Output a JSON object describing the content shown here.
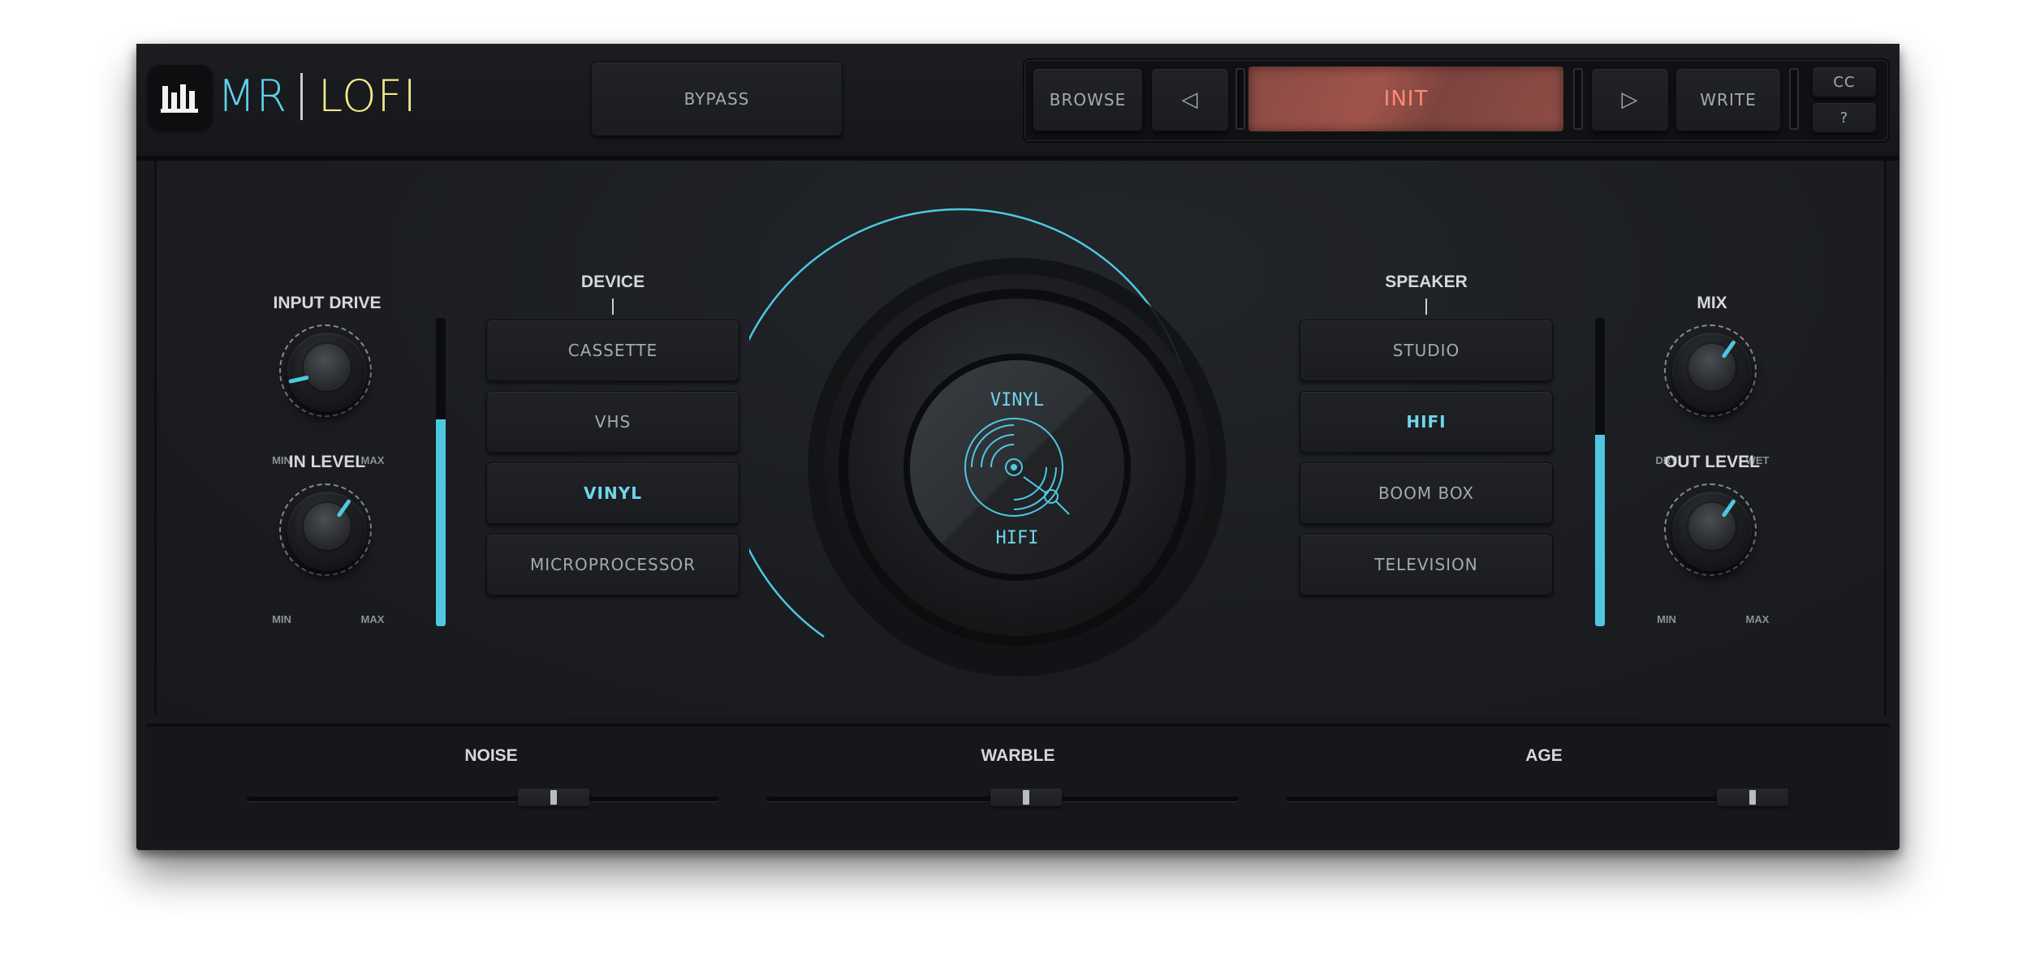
{
  "header": {
    "logo_left": "MR",
    "logo_right": "LOFI",
    "bypass_label": "BYPASS",
    "browse_label": "BROWSE",
    "prev_label": "◁",
    "preset_name": "INIT",
    "next_label": "▷",
    "write_label": "WRITE",
    "cc_label": "CC",
    "help_label": "?"
  },
  "left": {
    "input_drive": {
      "label": "INPUT DRIVE",
      "min": "MIN",
      "max": "MAX",
      "value": 0.12
    },
    "in_level": {
      "label": "IN LEVEL",
      "min": "MIN",
      "max": "MAX",
      "value": 0.63
    },
    "input_meter_level": 0.67
  },
  "device": {
    "label": "DEVICE",
    "options": [
      "CASSETTE",
      "VHS",
      "VINYL",
      "MICROPROCESSOR"
    ],
    "selected": "VINYL"
  },
  "center": {
    "device_text": "VINYL",
    "speaker_text": "HIFI",
    "icon": "vinyl-record-icon"
  },
  "speaker": {
    "label": "SPEAKER",
    "options": [
      "STUDIO",
      "HIFI",
      "BOOM BOX",
      "TELEVISION"
    ],
    "selected": "HIFI"
  },
  "right": {
    "mix": {
      "label": "MIX",
      "min": "DRY",
      "max": "WET",
      "value": 0.63
    },
    "out_level": {
      "label": "OUT LEVEL",
      "min": "MIN",
      "max": "MAX",
      "value": 0.63
    },
    "output_meter_level": 0.62
  },
  "bottom": {
    "noise": {
      "label": "NOISE",
      "value": 0.65
    },
    "warble": {
      "label": "WARBLE",
      "value": 0.55
    },
    "age": {
      "label": "AGE",
      "value": 0.93
    }
  },
  "colors": {
    "accent": "#4ec8e2",
    "logo_mr": "#5ed3ea",
    "logo_lofi": "#f3e98a",
    "preset_text": "#ff8a75"
  }
}
